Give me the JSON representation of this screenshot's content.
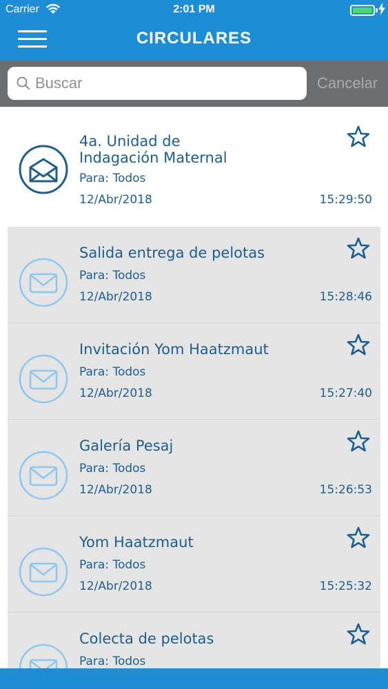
{
  "status_bar": {
    "carrier": "Carrier",
    "time": "2:01 PM",
    "wifi_icon": "wifi-icon",
    "battery_icon": "battery-icon",
    "battery_level": 1.0
  },
  "nav": {
    "title": "CIRCULARES",
    "menu_icon": "hamburger-menu-icon"
  },
  "search": {
    "placeholder": "Buscar",
    "value": "",
    "cancel_label": "Cancelar"
  },
  "colors": {
    "brand_blue": "#1d8ed6",
    "text_blue": "#1d5e8c",
    "read_icon": "#1d5e8c",
    "unread_icon": "#8cc8f2",
    "unread_bg": "#e5e5e6"
  },
  "items": [
    {
      "title_line1": "4a. Unidad de",
      "title_line2": "Indagación Maternal",
      "to": "Para: Todos",
      "date": "12/Abr/2018",
      "time": "15:29:50",
      "state": "read",
      "icon": "open-envelope-icon",
      "favorite_icon": "star-outline-icon"
    },
    {
      "title_line1": "Salida entrega de pelotas",
      "to": "Para: Todos",
      "date": "12/Abr/2018",
      "time": "15:28:46",
      "state": "unread",
      "icon": "closed-envelope-icon",
      "favorite_icon": "star-outline-icon"
    },
    {
      "title_line1": "Invitación Yom Haatzmaut",
      "to": "Para: Todos",
      "date": "12/Abr/2018",
      "time": "15:27:40",
      "state": "unread",
      "icon": "closed-envelope-icon",
      "favorite_icon": "star-outline-icon"
    },
    {
      "title_line1": "Galería Pesaj",
      "to": "Para: Todos",
      "date": "12/Abr/2018",
      "time": "15:26:53",
      "state": "unread",
      "icon": "closed-envelope-icon",
      "favorite_icon": "star-outline-icon"
    },
    {
      "title_line1": "Yom Haatzmaut",
      "to": "Para: Todos",
      "date": "12/Abr/2018",
      "time": "15:25:32",
      "state": "unread",
      "icon": "closed-envelope-icon",
      "favorite_icon": "star-outline-icon"
    },
    {
      "title_line1": "Colecta de pelotas",
      "to": "Para: Todos",
      "date": "",
      "time": "",
      "state": "unread",
      "icon": "closed-envelope-icon",
      "favorite_icon": "star-outline-icon"
    }
  ]
}
